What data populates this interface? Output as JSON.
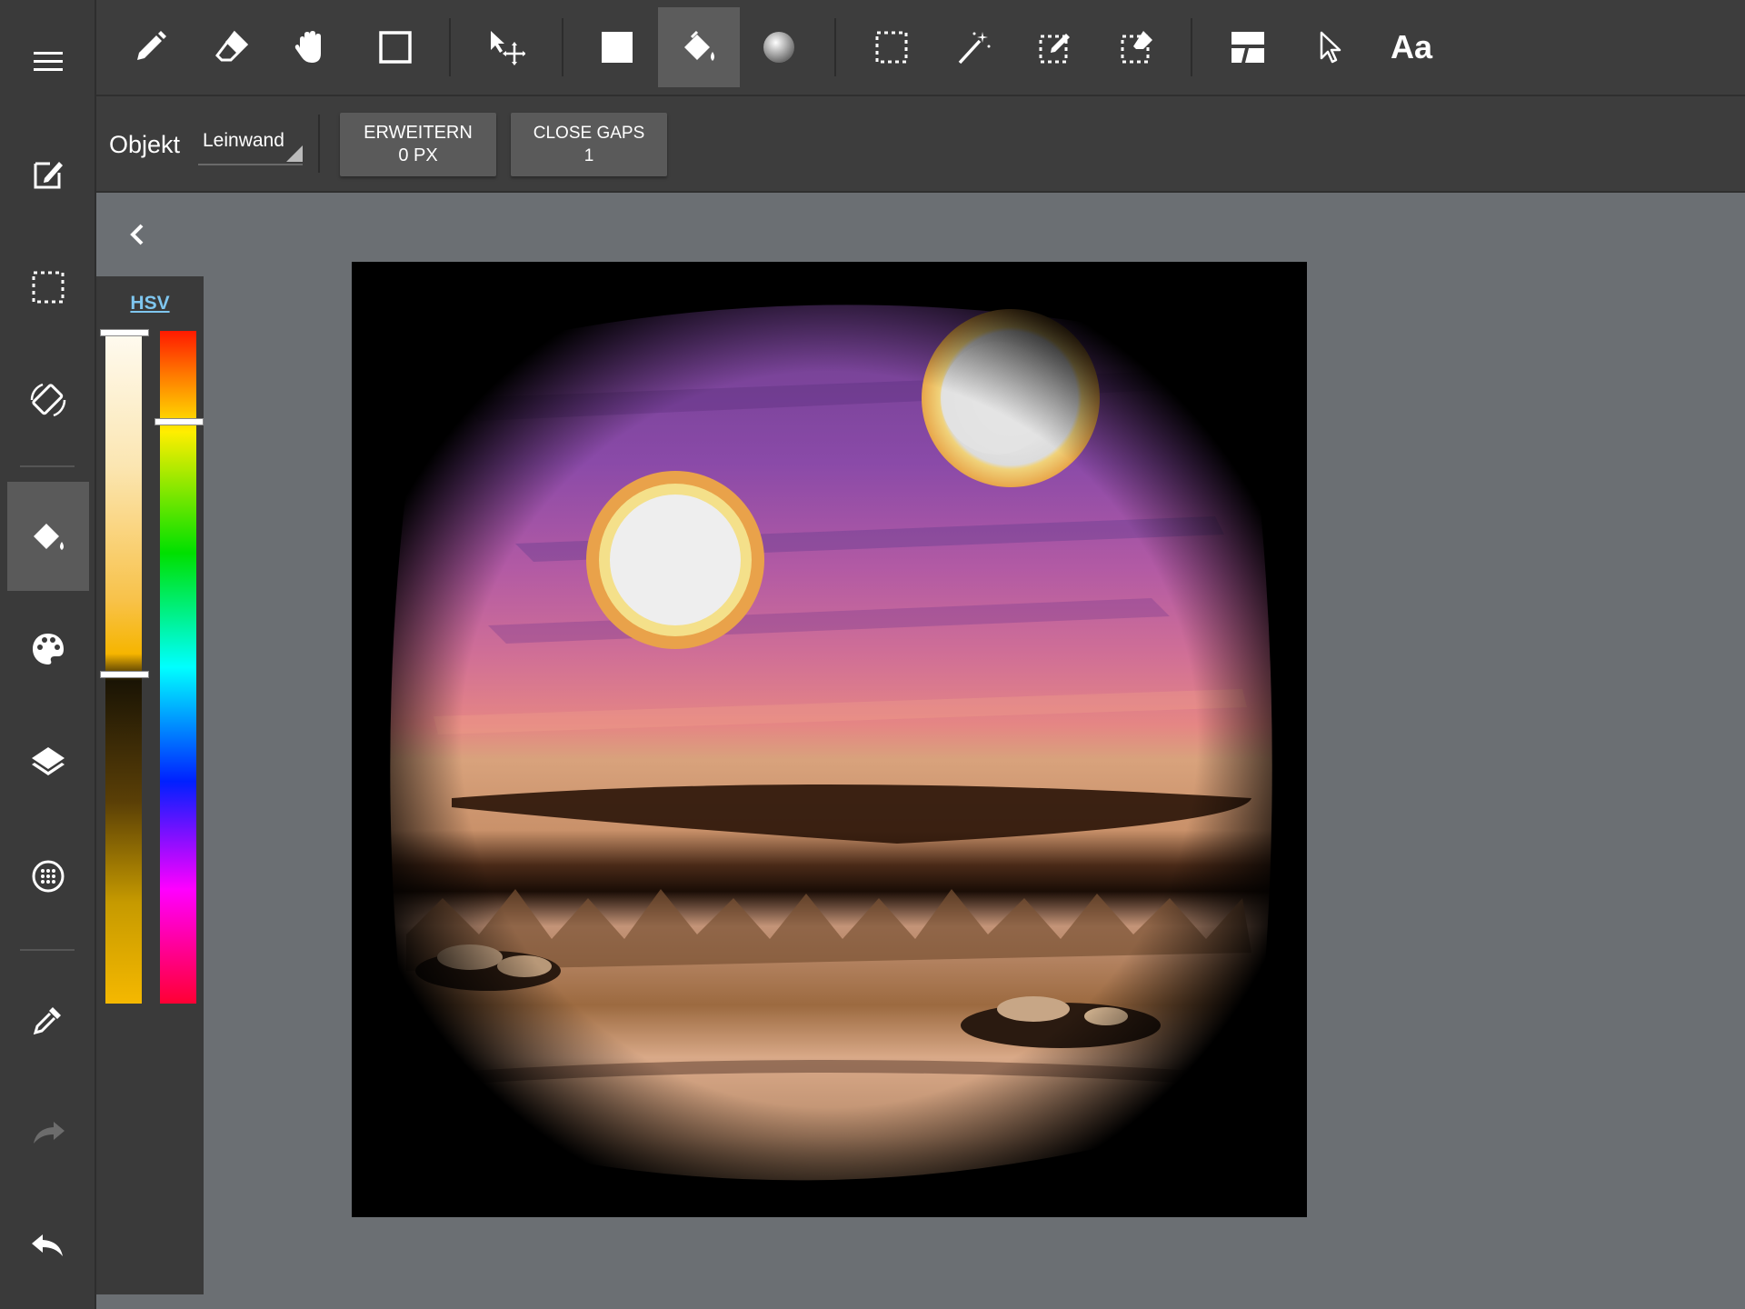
{
  "sidebar": {
    "items": [
      {
        "name": "menu",
        "icon": "hamburger-menu-icon"
      },
      {
        "name": "edit",
        "icon": "edit-document-icon"
      },
      {
        "name": "selection",
        "icon": "dashed-selection-icon"
      },
      {
        "name": "rotate",
        "icon": "rotate-screen-icon"
      },
      {
        "name": "fill",
        "icon": "paint-bucket-icon",
        "active": true
      },
      {
        "name": "palette",
        "icon": "palette-icon"
      },
      {
        "name": "layers",
        "icon": "layers-icon"
      },
      {
        "name": "grid",
        "icon": "dotted-circle-icon"
      },
      {
        "name": "eyedropper",
        "icon": "eyedropper-icon"
      },
      {
        "name": "redo",
        "icon": "redo-arrow-icon"
      },
      {
        "name": "undo",
        "icon": "undo-arrow-icon"
      }
    ]
  },
  "toolbar": {
    "tools": [
      {
        "name": "brush",
        "icon": "pencil-icon"
      },
      {
        "name": "eraser",
        "icon": "eraser-icon"
      },
      {
        "name": "hand",
        "icon": "hand-icon"
      },
      {
        "name": "shape",
        "icon": "square-outline-icon"
      },
      {
        "name": "transform",
        "icon": "move-arrow-icon"
      },
      {
        "name": "fill-rect",
        "icon": "filled-square-icon"
      },
      {
        "name": "bucket",
        "icon": "paint-bucket-icon",
        "active": true
      },
      {
        "name": "gradient",
        "icon": "gradient-sphere-icon"
      },
      {
        "name": "select-rect",
        "icon": "marquee-select-icon"
      },
      {
        "name": "magic-wand",
        "icon": "magic-wand-icon"
      },
      {
        "name": "select-pen",
        "icon": "select-pen-icon"
      },
      {
        "name": "select-eraser",
        "icon": "select-eraser-icon"
      },
      {
        "name": "frame-divider",
        "icon": "panel-divider-icon"
      },
      {
        "name": "pointer",
        "icon": "cursor-arrow-icon"
      }
    ],
    "text_tool_label": "Aa"
  },
  "options": {
    "object_label": "Objekt",
    "object_value": "Leinwand",
    "expand_button": {
      "line1": "ERWEITERN",
      "line2": "0 PX"
    },
    "close_gaps_button": {
      "line1": "CLOSE GAPS",
      "line2": "1"
    }
  },
  "color_panel": {
    "mode_label": "HSV",
    "current_color": "#f6b500"
  }
}
